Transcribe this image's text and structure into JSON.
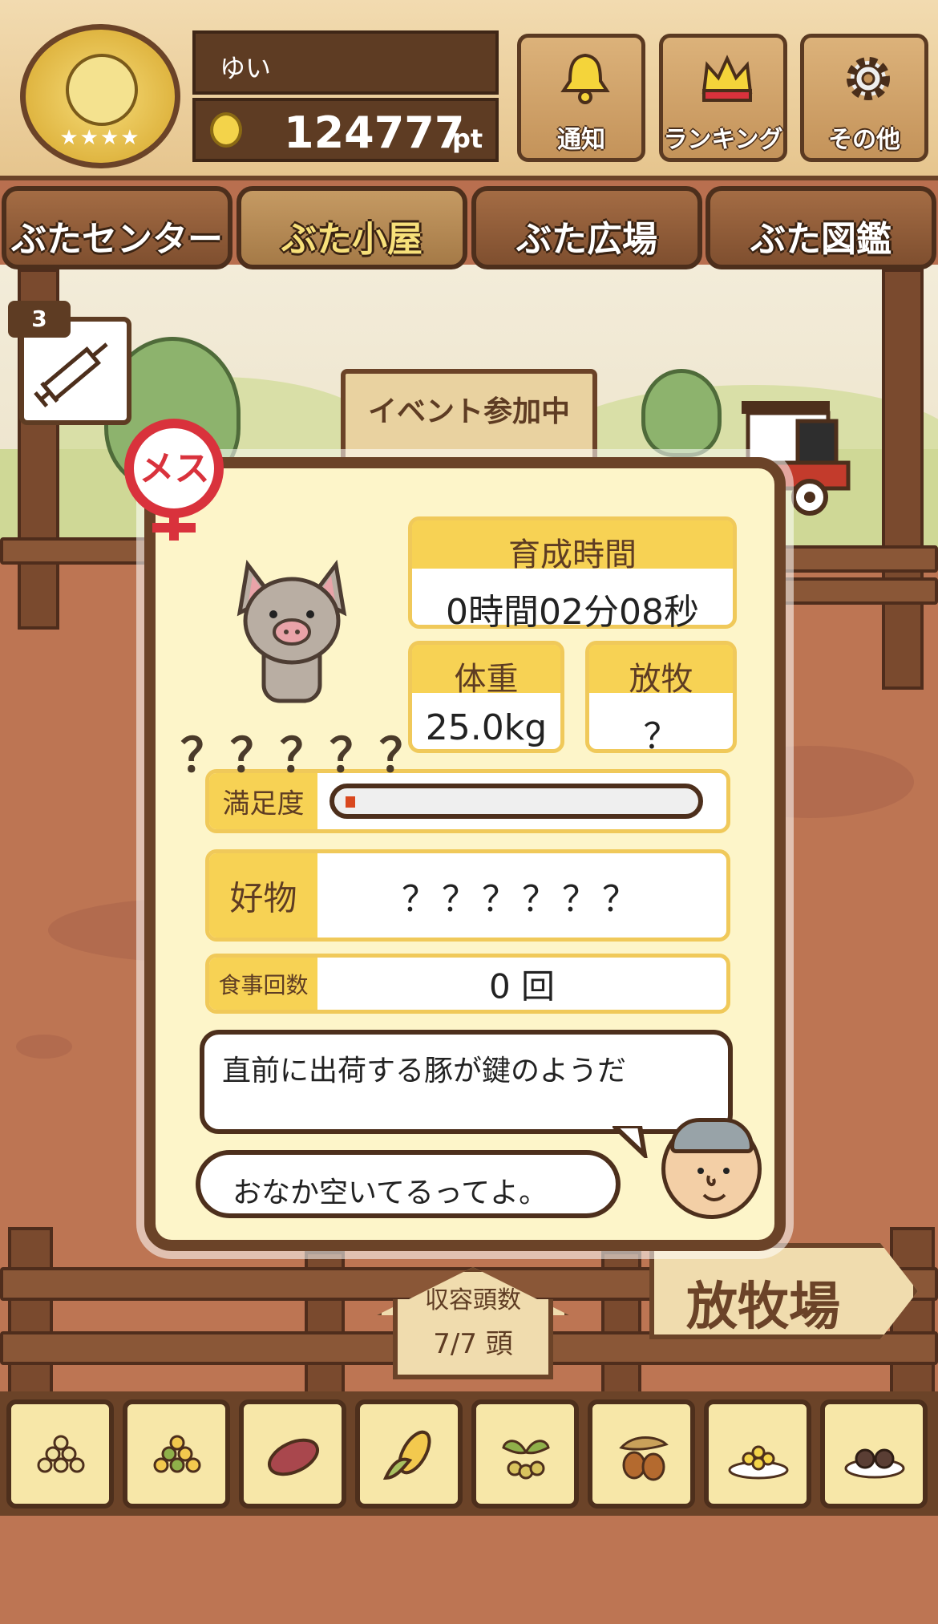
{
  "header": {
    "user_name": "ゆい",
    "points_value": "124777",
    "points_unit": "pt",
    "buttons": [
      {
        "label": "通知",
        "icon": "bell-icon"
      },
      {
        "label": "ランキング",
        "icon": "crown-icon"
      },
      {
        "label": "その他",
        "icon": "gear-icon"
      }
    ]
  },
  "tabs": [
    {
      "label": "ぶたセンター",
      "active": false
    },
    {
      "label": "ぶた小屋",
      "active": true
    },
    {
      "label": "ぶた広場",
      "active": false
    },
    {
      "label": "ぶた図鑑",
      "active": false
    }
  ],
  "item": {
    "syringe_count": "3",
    "icon": "syringe-icon"
  },
  "event_sign": {
    "text": "イベント参加中"
  },
  "pig_card": {
    "gender": "メス",
    "name": "？？？？？",
    "growth_time_label": "育成時間",
    "growth_time_value": "0時間02分08秒",
    "weight_label": "体重",
    "weight_value": "25.0kg",
    "pasture_label": "放牧",
    "pasture_value": "？",
    "satisfaction_label": "満足度",
    "satisfaction_level": 0.02,
    "favorite_label": "好物",
    "favorite_value": "？？？？？？",
    "meals_label": "食事回数",
    "meals_value": "0 回",
    "message": "直前に出荷する豚が鍵のようだ",
    "speech": "おなか空いてるってよ。"
  },
  "capacity": {
    "label": "収容頭数",
    "value": "7/7 頭"
  },
  "pasture_sign": {
    "label": "放牧場"
  },
  "foods": [
    {
      "icon": "grain-pile-icon"
    },
    {
      "icon": "mixed-grain-icon"
    },
    {
      "icon": "sweet-potato-icon"
    },
    {
      "icon": "corn-icon"
    },
    {
      "icon": "herbs-icon"
    },
    {
      "icon": "acorn-icon"
    },
    {
      "icon": "grain-plate-icon"
    },
    {
      "icon": "truffle-plate-icon"
    }
  ],
  "colors": {
    "wood_dark": "#6b4328",
    "panel_bg": "#fdf5c9",
    "label_yellow": "#f7d254",
    "female_red": "#d9323c"
  }
}
